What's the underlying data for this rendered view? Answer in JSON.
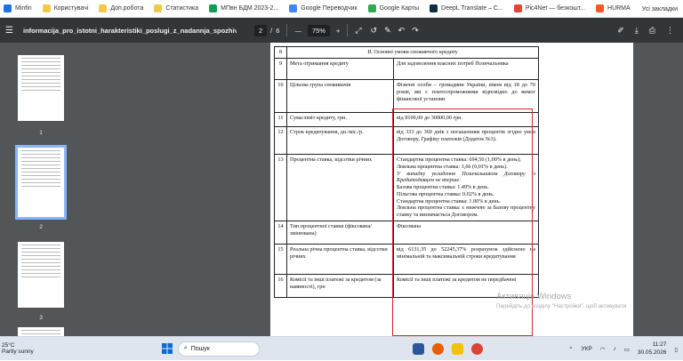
{
  "bookmarks": [
    {
      "label": "Minfin",
      "color": "#1a73e8"
    },
    {
      "label": "Користувачі",
      "color": "#f2c94c"
    },
    {
      "label": "Доп.робота",
      "color": "#f2c94c"
    },
    {
      "label": "Статистика",
      "color": "#f2c94c"
    },
    {
      "label": "МПвн БДМ 2023-2...",
      "color": "#0f9d58"
    },
    {
      "label": "Google Переводчик",
      "color": "#4285f4"
    },
    {
      "label": "Google Карты",
      "color": "#34a853"
    },
    {
      "label": "DeepL Translate – С...",
      "color": "#0f2b46"
    },
    {
      "label": "Pic4Net — безкошт...",
      "color": "#e94235"
    },
    {
      "label": "HURMA",
      "color": "#ff5722"
    }
  ],
  "bookmarks_all": "Усі закладки",
  "toolbar": {
    "filename": "informacija_pro_istotni_harakteristiki_poslugi_z_nadannja_spozhivchogo20...",
    "page_current": "2",
    "page_sep": "/",
    "page_total": "6",
    "zoom_minus": "—",
    "zoom_value": "75%",
    "zoom_plus": "+"
  },
  "thumbnails": [
    {
      "num": "1"
    },
    {
      "num": "2"
    },
    {
      "num": "3"
    }
  ],
  "doc": {
    "rows": [
      {
        "n": "8",
        "section": "II. Основні умови споживчого кредиту"
      },
      {
        "n": "9",
        "k": "Мета отримання кредиту",
        "v": "Для задоволення власних потреб Позичальника"
      },
      {
        "n": "10",
        "k": "Цільова група споживачів",
        "v": "Фізичні особи – громадяни України, віком від 18 до 70 років, які є платоспроможними відповідно до вимог фінансової установи"
      },
      {
        "n": "11",
        "k": "Сума/ліміт кредиту, грн.",
        "v": "від 8100,00 до 30000,00 грн."
      },
      {
        "n": "12",
        "k": "Строк кредитування, дн./міс./р.",
        "v": "від 333 до 360 днів з погашенням процентів згідно умов Договору, Графіку платежів (Додаток №3)."
      },
      {
        "n": "13",
        "k": "Процентна ставка, відсотки річних"
      },
      {
        "n": "14",
        "k": "Тип процентної ставки (фіксована/змінювана)",
        "v": "Фіксована"
      },
      {
        "n": "15",
        "k": "Реальна річна процентна ставка, відсотки річних",
        "v": "від 6131,35 до 52245,37% розрахунок здійснено на мінімальній та максимальній строки кредитування"
      },
      {
        "n": "16",
        "k": "Комісії та інші платежі за кредитом (за наявності), грн",
        "v": "Комісії та інші платежі за кредитом не передбачені"
      }
    ],
    "rate": {
      "p1": "Стандартна процентна ставка: 694,50 (1,00% в день);",
      "p2": "Лояльна процентна ставка: 3,66 (0,01% в день).",
      "p3": "У випадку укладення Позичальником Договору із Кредитодавцем не вперше:",
      "p4": "Базова процентна ставка: 1.49% в день.",
      "p5": "Пільгова процентна ставка: 0.02% в день.",
      "p6": "Стандартна процентна ставка: 1.00% в день.",
      "p7": "Лояльна процентна ставка: є нижчою за Базову процентну ставку та визначається Договором."
    }
  },
  "watermark": {
    "title": "Активація Windows",
    "sub": "Перейдіть до розділу \"Настройки\", щоб активувати"
  },
  "taskbar": {
    "temp": "25°C",
    "weather": "Partly sunny",
    "search": "Пошук",
    "lang": "УКР",
    "time": "11:27",
    "date": "30.05.2026"
  },
  "colors": {
    "toolbar": "#323639",
    "viewer": "#525659",
    "highlight": "#d9252b"
  }
}
